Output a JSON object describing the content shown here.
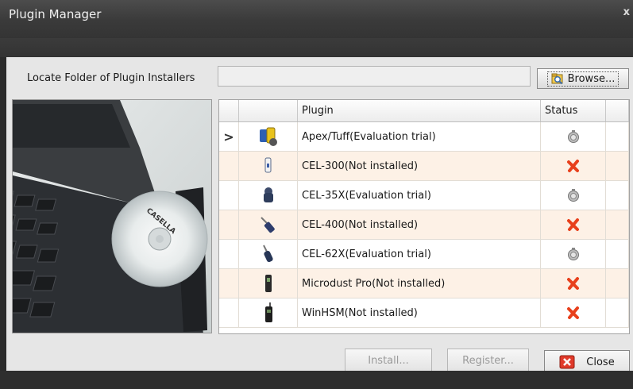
{
  "window": {
    "title": "Plugin Manager",
    "close_glyph": "x"
  },
  "locate": {
    "label": "Locate Folder of Plugin Installers",
    "value": "",
    "placeholder": ""
  },
  "browse": {
    "label": "Browse...",
    "icon": "folder-search-icon"
  },
  "grid": {
    "columns": [
      "",
      "",
      "Plugin",
      "Status",
      ""
    ],
    "rows": [
      {
        "selected": true,
        "name": "Apex/Tuff(Evaluation trial)",
        "status": "evaluation",
        "icon": "apex-tuff-device-icon"
      },
      {
        "selected": false,
        "name": "CEL-300(Not installed)",
        "status": "not-installed",
        "icon": "cel-300-device-icon"
      },
      {
        "selected": false,
        "name": "CEL-35X(Evaluation trial)",
        "status": "evaluation",
        "icon": "cel-35x-device-icon"
      },
      {
        "selected": false,
        "name": "CEL-400(Not installed)",
        "status": "not-installed",
        "icon": "cel-400-device-icon"
      },
      {
        "selected": false,
        "name": "CEL-62X(Evaluation trial)",
        "status": "evaluation",
        "icon": "cel-62x-device-icon"
      },
      {
        "selected": false,
        "name": "Microdust Pro(Not installed)",
        "status": "not-installed",
        "icon": "microdust-pro-device-icon"
      },
      {
        "selected": false,
        "name": "WinHSM(Not installed)",
        "status": "not-installed",
        "icon": "winhsm-device-icon"
      }
    ],
    "selected_marker": ">"
  },
  "photo": {
    "cd_label": "CASELLA"
  },
  "buttons": {
    "install": "Install...",
    "register": "Register...",
    "close": "Close"
  },
  "colors": {
    "alt_row": "#fdf1e6",
    "not_installed": "#e8401c",
    "title_bar": "#3f3f3f"
  }
}
